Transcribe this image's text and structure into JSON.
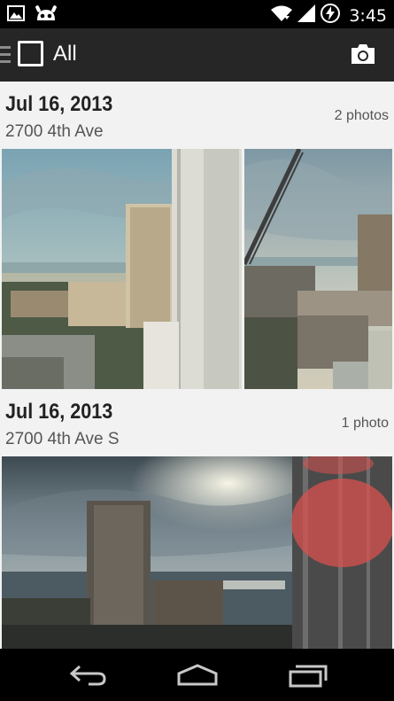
{
  "status_bar": {
    "time": "3:45",
    "icons": [
      "picture-icon",
      "android-icon",
      "wifi-icon",
      "signal-icon",
      "battery-icon"
    ]
  },
  "action_bar": {
    "title": "All",
    "icons": [
      "menu-icon",
      "select-all-checkbox",
      "camera-icon"
    ]
  },
  "groups": [
    {
      "date": "Jul 16, 2013",
      "place": "2700 4th Ave",
      "count": "2 photos"
    },
    {
      "date": "Jul 16, 2013",
      "place": "2700 4th Ave S",
      "count": "1 photo"
    }
  ],
  "nav_bar": {
    "icons": [
      "back-icon",
      "home-icon",
      "recents-icon"
    ]
  },
  "colors": {
    "status_bar": "#000000",
    "action_bar": "#262626",
    "content_bg": "#f2f2f2",
    "text_dark": "#222222",
    "text_muted": "#555555"
  }
}
